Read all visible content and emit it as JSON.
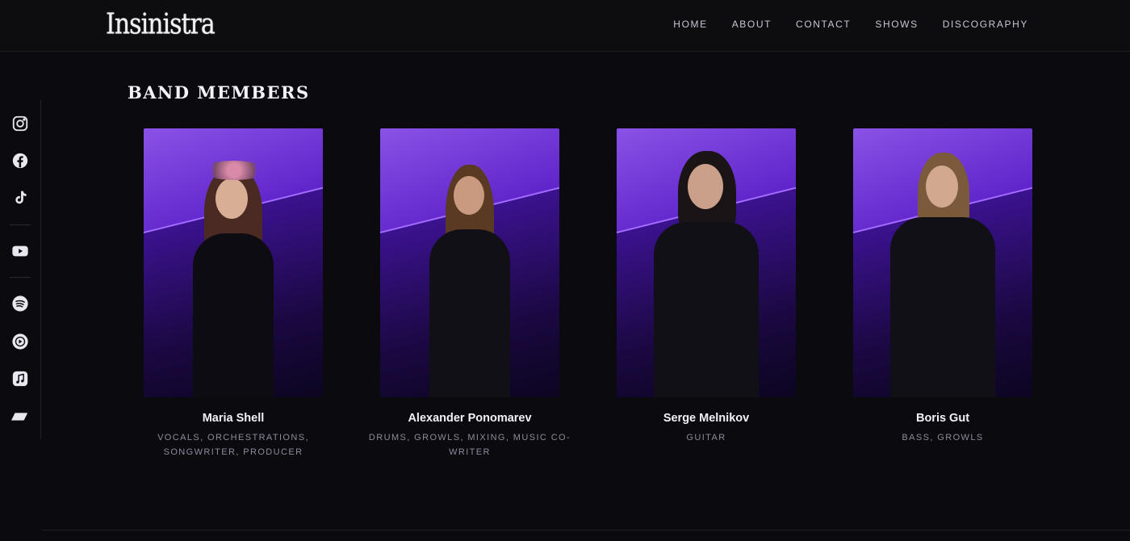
{
  "header": {
    "logo_text": "Insinistra",
    "nav": [
      "HOME",
      "ABOUT",
      "CONTACT",
      "SHOWS",
      "DISCOGRAPHY"
    ]
  },
  "social": [
    "instagram-icon",
    "facebook-icon",
    "tiktok-icon",
    "youtube-icon",
    "spotify-icon",
    "youtube-music-icon",
    "apple-music-icon",
    "deezer-icon"
  ],
  "section": {
    "title": "BAND MEMBERS"
  },
  "members": [
    {
      "name": "Maria Shell",
      "role": "VOCALS, ORCHESTRATIONS, SONGWRITER, PRODUCER"
    },
    {
      "name": "Alexander Ponomarev",
      "role": "DRUMS, GROWLS, MIXING, MUSIC CO-WRITER"
    },
    {
      "name": "Serge Melnikov",
      "role": "GUITAR"
    },
    {
      "name": "Boris Gut",
      "role": "BASS, GROWLS"
    }
  ],
  "colors": {
    "background": "#0b0b0f",
    "accent": "#6a2be0",
    "text_muted": "#8e8a9c"
  }
}
